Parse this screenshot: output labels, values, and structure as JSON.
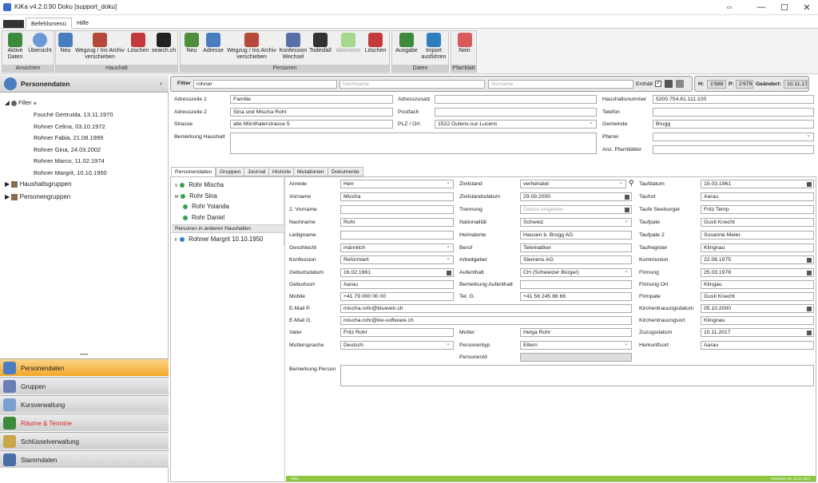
{
  "window": {
    "title": "KiKa v4.2.0.90 Doku [support_doku]",
    "controls": [
      "⇔",
      "—",
      "☐",
      "✕"
    ]
  },
  "menu": {
    "tabs": [
      "Befehlsmenü",
      "Hilfe"
    ]
  },
  "ribbon": {
    "groups": [
      {
        "label": "Ansichten",
        "buttons": [
          "Aktive Daten",
          "Übersicht"
        ]
      },
      {
        "label": "Haushalt",
        "buttons": [
          "Neu",
          "Wegzug / Ins Archiv verschieben",
          "Löschen",
          "search.ch"
        ]
      },
      {
        "label": "Personen",
        "buttons": [
          "Neu",
          "Adresse",
          "Wegzug / Ins Archiv verschieben",
          "Konfession Wechsel",
          "Todesfall",
          "Aktivieren",
          "Löschen"
        ]
      },
      {
        "label": "Daten",
        "buttons": [
          "Ausgabe",
          "Import ausführen"
        ]
      },
      {
        "label": "Pfarrblatt",
        "buttons": [
          "Nein"
        ]
      }
    ]
  },
  "left": {
    "title": "Personendaten",
    "filter_label": "Filter",
    "filter_items": [
      "Fouché Gertruida, 13.11.1970",
      "Rohner Celina, 03.10.1972",
      "Rohner Fabia, 21.08.1999",
      "Rohner Gina, 24.03.2002",
      "Rohner Marco, 11.02.1974",
      "Rohner Margrit, 10.10.1950"
    ],
    "groups": [
      "Haushaltsgruppen",
      "Personengruppen"
    ],
    "nav": [
      "Personendaten",
      "Gruppen",
      "Kursverwaltung",
      "Räume & Termine",
      "Schlüsselverwaltung",
      "Stammdaten"
    ]
  },
  "filter": {
    "label": "Filter",
    "value": "rohner",
    "nachname_ph": "Nachname",
    "vorname_ph": "Vorname",
    "enthalt": "Enthält"
  },
  "stats": {
    "h_label": "H:",
    "h": "1'688",
    "p_label": "P:",
    "p": "2'679",
    "g_label": "Geändert:",
    "g": "10.11.17"
  },
  "household": {
    "adresszeile1_l": "Adresszeile 1",
    "adresszeile1": "Familie",
    "adresszeile2_l": "Adresszeile 2",
    "adresszeile2": "Sina und Mischa Rohr",
    "strasse_l": "Strasse",
    "strasse": "alte Mönthalerstrasse 5",
    "bemerkung_l": "Bemerkung Haushalt",
    "adresszusatz_l": "Adresszusatz",
    "postfach_l": "Postfach",
    "plz_l": "PLZ / Ort",
    "plz": "1522 Oulens-sur-Lucens",
    "hhnr_l": "Haushaltsnummer",
    "hhnr": "5200.754.61.111.100",
    "telefon_l": "Telefon",
    "gemeinde_l": "Gemeinde",
    "gemeinde": "Brugg",
    "pfarrei_l": "Pfarrei",
    "anz_l": "Anz. Pfarrblätter"
  },
  "ptabs": [
    "Personendaten",
    "Gruppen",
    "Journal",
    "Historie",
    "Mutationen",
    "Dokumente"
  ],
  "persons": [
    {
      "mark": "V",
      "name": "Rohr Mischa"
    },
    {
      "mark": "M",
      "name": "Rohr Sina"
    },
    {
      "mark": "",
      "name": "Rohr Yolanda"
    },
    {
      "mark": "",
      "name": "Rohr Daniel"
    }
  ],
  "other_hh_label": "Personen in anderen Haushalten",
  "other_person": {
    "mark": "F",
    "name": "Rohner Margrit 10.10.1950"
  },
  "person": {
    "anrede_l": "Anrede",
    "anrede": "Herr",
    "vorname_l": "Vorname",
    "vorname": "Mischa",
    "vorname2_l": "2. Vorname",
    "nachname_l": "Nachname",
    "nachname": "Rohr",
    "ledig_l": "Ledigname",
    "geschlecht_l": "Geschlecht",
    "geschlecht": "männlich",
    "konfession_l": "Konfession",
    "konfession": "Reformiert",
    "gebdatum_l": "Geburtsdatum",
    "gebdatum": "16.02.1961",
    "gebort_l": "Geburtsort",
    "gebort": "Aarau",
    "mobile_l": "Mobile",
    "mobile": "+41 79 000 00 00",
    "emailp_l": "E-Mail P.",
    "emailp": "mischa.rohr@bluewin.ch",
    "emailg_l": "E-Mail G.",
    "emailg": "mischa.rohr@kw-software.ch",
    "vater_l": "Vater",
    "vater": "Fritz Rohr",
    "mutterspr_l": "Muttersprache",
    "mutterspr": "Deutsch",
    "bemerk_l": "Bemerkung Person",
    "zivil_l": "Zivilstand",
    "zivil": "verheiratet",
    "zivildat_l": "Zivilstandsdatum",
    "zivildat": "29.09.2000",
    "trennung_l": "Trennung",
    "trennung_ph": "Datum eingeben",
    "nation_l": "Nationalität",
    "nation": "Schweiz",
    "heimat_l": "Heimatorte",
    "heimat": "Hausen b. Brugg AG",
    "beruf_l": "Beruf",
    "beruf": "Telematiker",
    "arbeit_l": "Arbeitgeber",
    "arbeit": "Siemens AG",
    "aufent_l": "Aufenthalt",
    "aufent": "CH (Schweizer Bürger)",
    "bemaufent_l": "Bemerkung Aufenthalt",
    "telg_l": "Tel. G.",
    "telg": "+41 56 245 86 66",
    "mutter_l": "Mutter",
    "mutter": "Helga Rohr",
    "ptyp_l": "Personentyp",
    "ptyp": "Eltern",
    "pid_l": "PersonenId",
    "taufdat_l": "Taufdatum",
    "taufdat": "15.03.1961",
    "taufort_l": "Taufort",
    "taufort": "Aarau",
    "taufseel_l": "Taufe Seelsorger",
    "taufseel": "Fritz Temp",
    "taufpate_l": "Taufpate",
    "taufpate": "Gusti Knecht",
    "taufpate2_l": "Taufpate 2",
    "taufpate2": "Susanne Meier",
    "taufreg_l": "Taufregister",
    "taufreg": "Klingnau",
    "kommunion_l": "Kommunion",
    "kommunion": "22.06.1975",
    "firmung_l": "Firmung",
    "firmung": "25.03.1978",
    "firmort_l": "Firmung Ort",
    "firmort": "Klingau",
    "firmpate_l": "Firmpate",
    "firmpate": "Gusti Knecht",
    "ktdat_l": "Kirchentrauungsdatum",
    "ktdat": "05.10.2000",
    "ktort_l": "Kirchentrauungsort",
    "ktort": "Klingnau",
    "zuzug_l": "Zuzugsdatum",
    "zuzug": "10.11.2017",
    "herkunft_l": "Herkunftsort",
    "herkunft": "Aarau"
  },
  "statusbar": {
    "left": "Aktiv",
    "right": "Geändert am 10.11.2017"
  }
}
